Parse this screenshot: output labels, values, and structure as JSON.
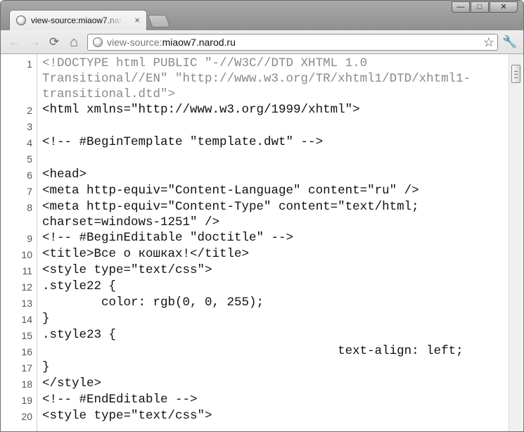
{
  "tab": {
    "title": "view-source:miaow7.narod.ru",
    "close": "×"
  },
  "window_controls": {
    "minimize": "—",
    "maximize": "□",
    "close": "✕"
  },
  "toolbar": {
    "back": "←",
    "forward": "→",
    "reload": "⟳",
    "home": "⌂",
    "url_prefix": "view-source:",
    "url_host": "miaow7.narod.ru",
    "star": "☆",
    "wrench": "🔧"
  },
  "source_lines": [
    {
      "n": "1",
      "text": "<!DOCTYPE html PUBLIC \"-//W3C//DTD XHTML 1.0 Transitional//EN\" \"http://www.w3.org/TR/xhtml1/DTD/xhtml1-transitional.dtd\">",
      "comment": true
    },
    {
      "n": "2",
      "text": "<html xmlns=\"http://www.w3.org/1999/xhtml\">",
      "comment": false
    },
    {
      "n": "3",
      "text": "",
      "comment": false
    },
    {
      "n": "4",
      "text": "<!-- #BeginTemplate \"template.dwt\" -->",
      "comment": false
    },
    {
      "n": "5",
      "text": "",
      "comment": false
    },
    {
      "n": "6",
      "text": "<head>",
      "comment": false
    },
    {
      "n": "7",
      "text": "<meta http-equiv=\"Content-Language\" content=\"ru\" />",
      "comment": false
    },
    {
      "n": "8",
      "text": "<meta http-equiv=\"Content-Type\" content=\"text/html; charset=windows-1251\" />",
      "comment": false
    },
    {
      "n": "9",
      "text": "<!-- #BeginEditable \"doctitle\" -->",
      "comment": false
    },
    {
      "n": "10",
      "text": "<title>Все о кошках!</title>",
      "comment": false
    },
    {
      "n": "11",
      "text": "<style type=\"text/css\">",
      "comment": false
    },
    {
      "n": "12",
      "text": ".style22 {",
      "comment": false
    },
    {
      "n": "13",
      "text": "        color: rgb(0, 0, 255);",
      "comment": false
    },
    {
      "n": "14",
      "text": "}",
      "comment": false
    },
    {
      "n": "15",
      "text": ".style23 {",
      "comment": false
    },
    {
      "n": "16",
      "text": "                                        text-align: left;",
      "comment": false
    },
    {
      "n": "17",
      "text": "}",
      "comment": false
    },
    {
      "n": "18",
      "text": "</style>",
      "comment": false
    },
    {
      "n": "19",
      "text": "<!-- #EndEditable -->",
      "comment": false
    },
    {
      "n": "20",
      "text": "<style type=\"text/css\">",
      "comment": false
    }
  ]
}
